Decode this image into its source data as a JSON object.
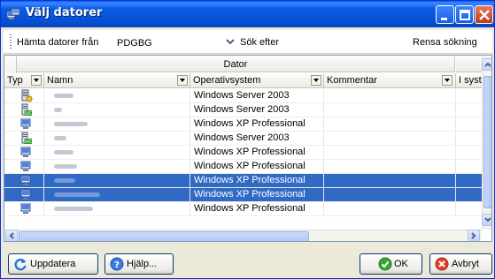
{
  "window": {
    "title": "Välj datorer"
  },
  "toolbar": {
    "source_label": "Hämta datorer från",
    "source_value": "PDGBG",
    "search_label": "Sök efter",
    "search_value": "",
    "clear_label": "Rensa sökning"
  },
  "grid": {
    "group_header": "Dator",
    "columns": {
      "type": "Typ",
      "name": "Namn",
      "os": "Operativsystem",
      "comment": "Kommentar",
      "in_system": "I syst"
    },
    "rows": [
      {
        "icon": "server-icon",
        "os": "Windows Server 2003",
        "selected": false
      },
      {
        "icon": "server-green-icon",
        "os": "Windows Server 2003",
        "selected": false
      },
      {
        "icon": "workstation-icon",
        "os": "Windows XP Professional",
        "selected": false
      },
      {
        "icon": "server-green-icon",
        "os": "Windows Server 2003",
        "selected": false
      },
      {
        "icon": "workstation-icon",
        "os": "Windows XP Professional",
        "selected": false
      },
      {
        "icon": "workstation-icon",
        "os": "Windows XP Professional",
        "selected": false
      },
      {
        "icon": "workstation-icon",
        "os": "Windows XP Professional",
        "selected": true
      },
      {
        "icon": "workstation-icon",
        "os": "Windows XP Professional",
        "selected": true
      },
      {
        "icon": "workstation-icon",
        "os": "Windows XP Professional",
        "selected": false
      }
    ]
  },
  "buttons": {
    "refresh": "Uppdatera",
    "help": "Hjälp...",
    "ok": "OK",
    "cancel": "Avbryt"
  },
  "colors": {
    "title_bar": "#0852d6",
    "selection": "#316ac5",
    "window_bg": "#ece9d8"
  }
}
